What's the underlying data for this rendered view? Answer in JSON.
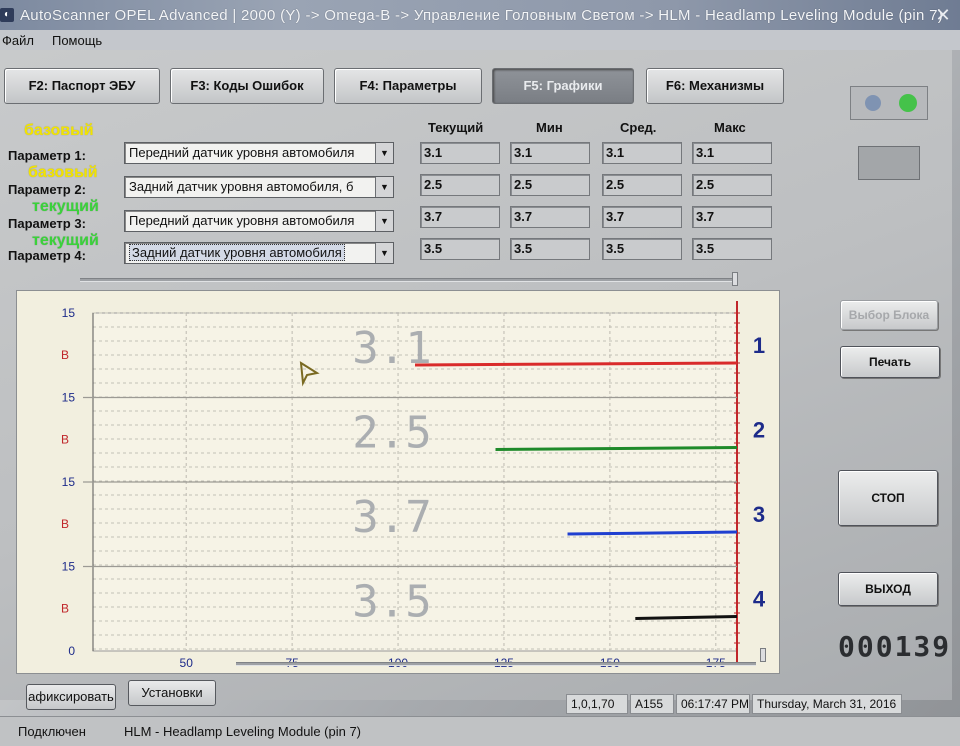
{
  "window": {
    "title": "AutoScanner OPEL Advanced | 2000 (Y) -> Omega-B -> Управление Головным Светом -> HLM - Headlamp Leveling Module (pin 7)",
    "close_glyph": "✕"
  },
  "menu": {
    "file": "Файл",
    "help": "Помощь"
  },
  "tabs": [
    {
      "label": "F2: Паспорт ЭБУ",
      "active": false
    },
    {
      "label": "F3: Коды Ошибок",
      "active": false
    },
    {
      "label": "F4: Параметры",
      "active": false
    },
    {
      "label": "F5: Графики",
      "active": true
    },
    {
      "label": "F6: Механизмы",
      "active": false
    }
  ],
  "columns": {
    "current": "Текущий",
    "min": "Мин",
    "avg": "Сред.",
    "max": "Макс"
  },
  "annotations": [
    "базовый",
    "базовый",
    "текущий",
    "текущий"
  ],
  "params": [
    {
      "label": "Параметр 1:",
      "value": "Передний датчик уровня автомобиля",
      "current": "3.1",
      "min": "3.1",
      "avg": "3.1",
      "max": "3.1"
    },
    {
      "label": "Параметр 2:",
      "value": "Задний датчик уровня автомобиля, б",
      "current": "2.5",
      "min": "2.5",
      "avg": "2.5",
      "max": "2.5"
    },
    {
      "label": "Параметр 3:",
      "value": "Передний датчик уровня автомобиля",
      "current": "3.7",
      "min": "3.7",
      "avg": "3.7",
      "max": "3.7"
    },
    {
      "label": "Параметр 4:",
      "value": "Задний датчик уровня автомобиля",
      "current": "3.5",
      "min": "3.5",
      "avg": "3.5",
      "max": "3.5"
    }
  ],
  "chart_data": {
    "type": "line",
    "x_ticks": [
      50,
      75,
      100,
      125,
      150,
      175
    ],
    "xlim": [
      28,
      180
    ],
    "lanes": [
      {
        "top_tick": "15",
        "unit": "В",
        "big_value": "3.1",
        "number": "1",
        "color": "#d92b2b",
        "start_x": 104,
        "end_x": 180
      },
      {
        "top_tick": "15",
        "unit": "В",
        "big_value": "2.5",
        "number": "2",
        "color": "#1f8a2a",
        "start_x": 123,
        "end_x": 180
      },
      {
        "top_tick": "15",
        "unit": "В",
        "big_value": "3.7",
        "number": "3",
        "color": "#1f3fd0",
        "start_x": 140,
        "end_x": 180
      },
      {
        "top_tick": "15",
        "unit": "В",
        "big_value": "3.5",
        "number": "4",
        "color": "#111111",
        "start_x": 156,
        "end_x": 180
      }
    ],
    "bottom_tick": "0"
  },
  "buttons": {
    "select_block": "Выбор Блока",
    "print": "Печать",
    "stop": "СТОП",
    "exit": "ВЫХОД",
    "fix": "афиксировать",
    "settings": "Установки"
  },
  "counter": "000139",
  "status": {
    "coords": "1,0,1,70",
    "code": "A155",
    "time": "06:17:47 PM",
    "date": "Thursday, March 31, 2016"
  },
  "statusbar": {
    "state": "Подключен",
    "module": "HLM - Headlamp Leveling Module (pin 7)"
  }
}
